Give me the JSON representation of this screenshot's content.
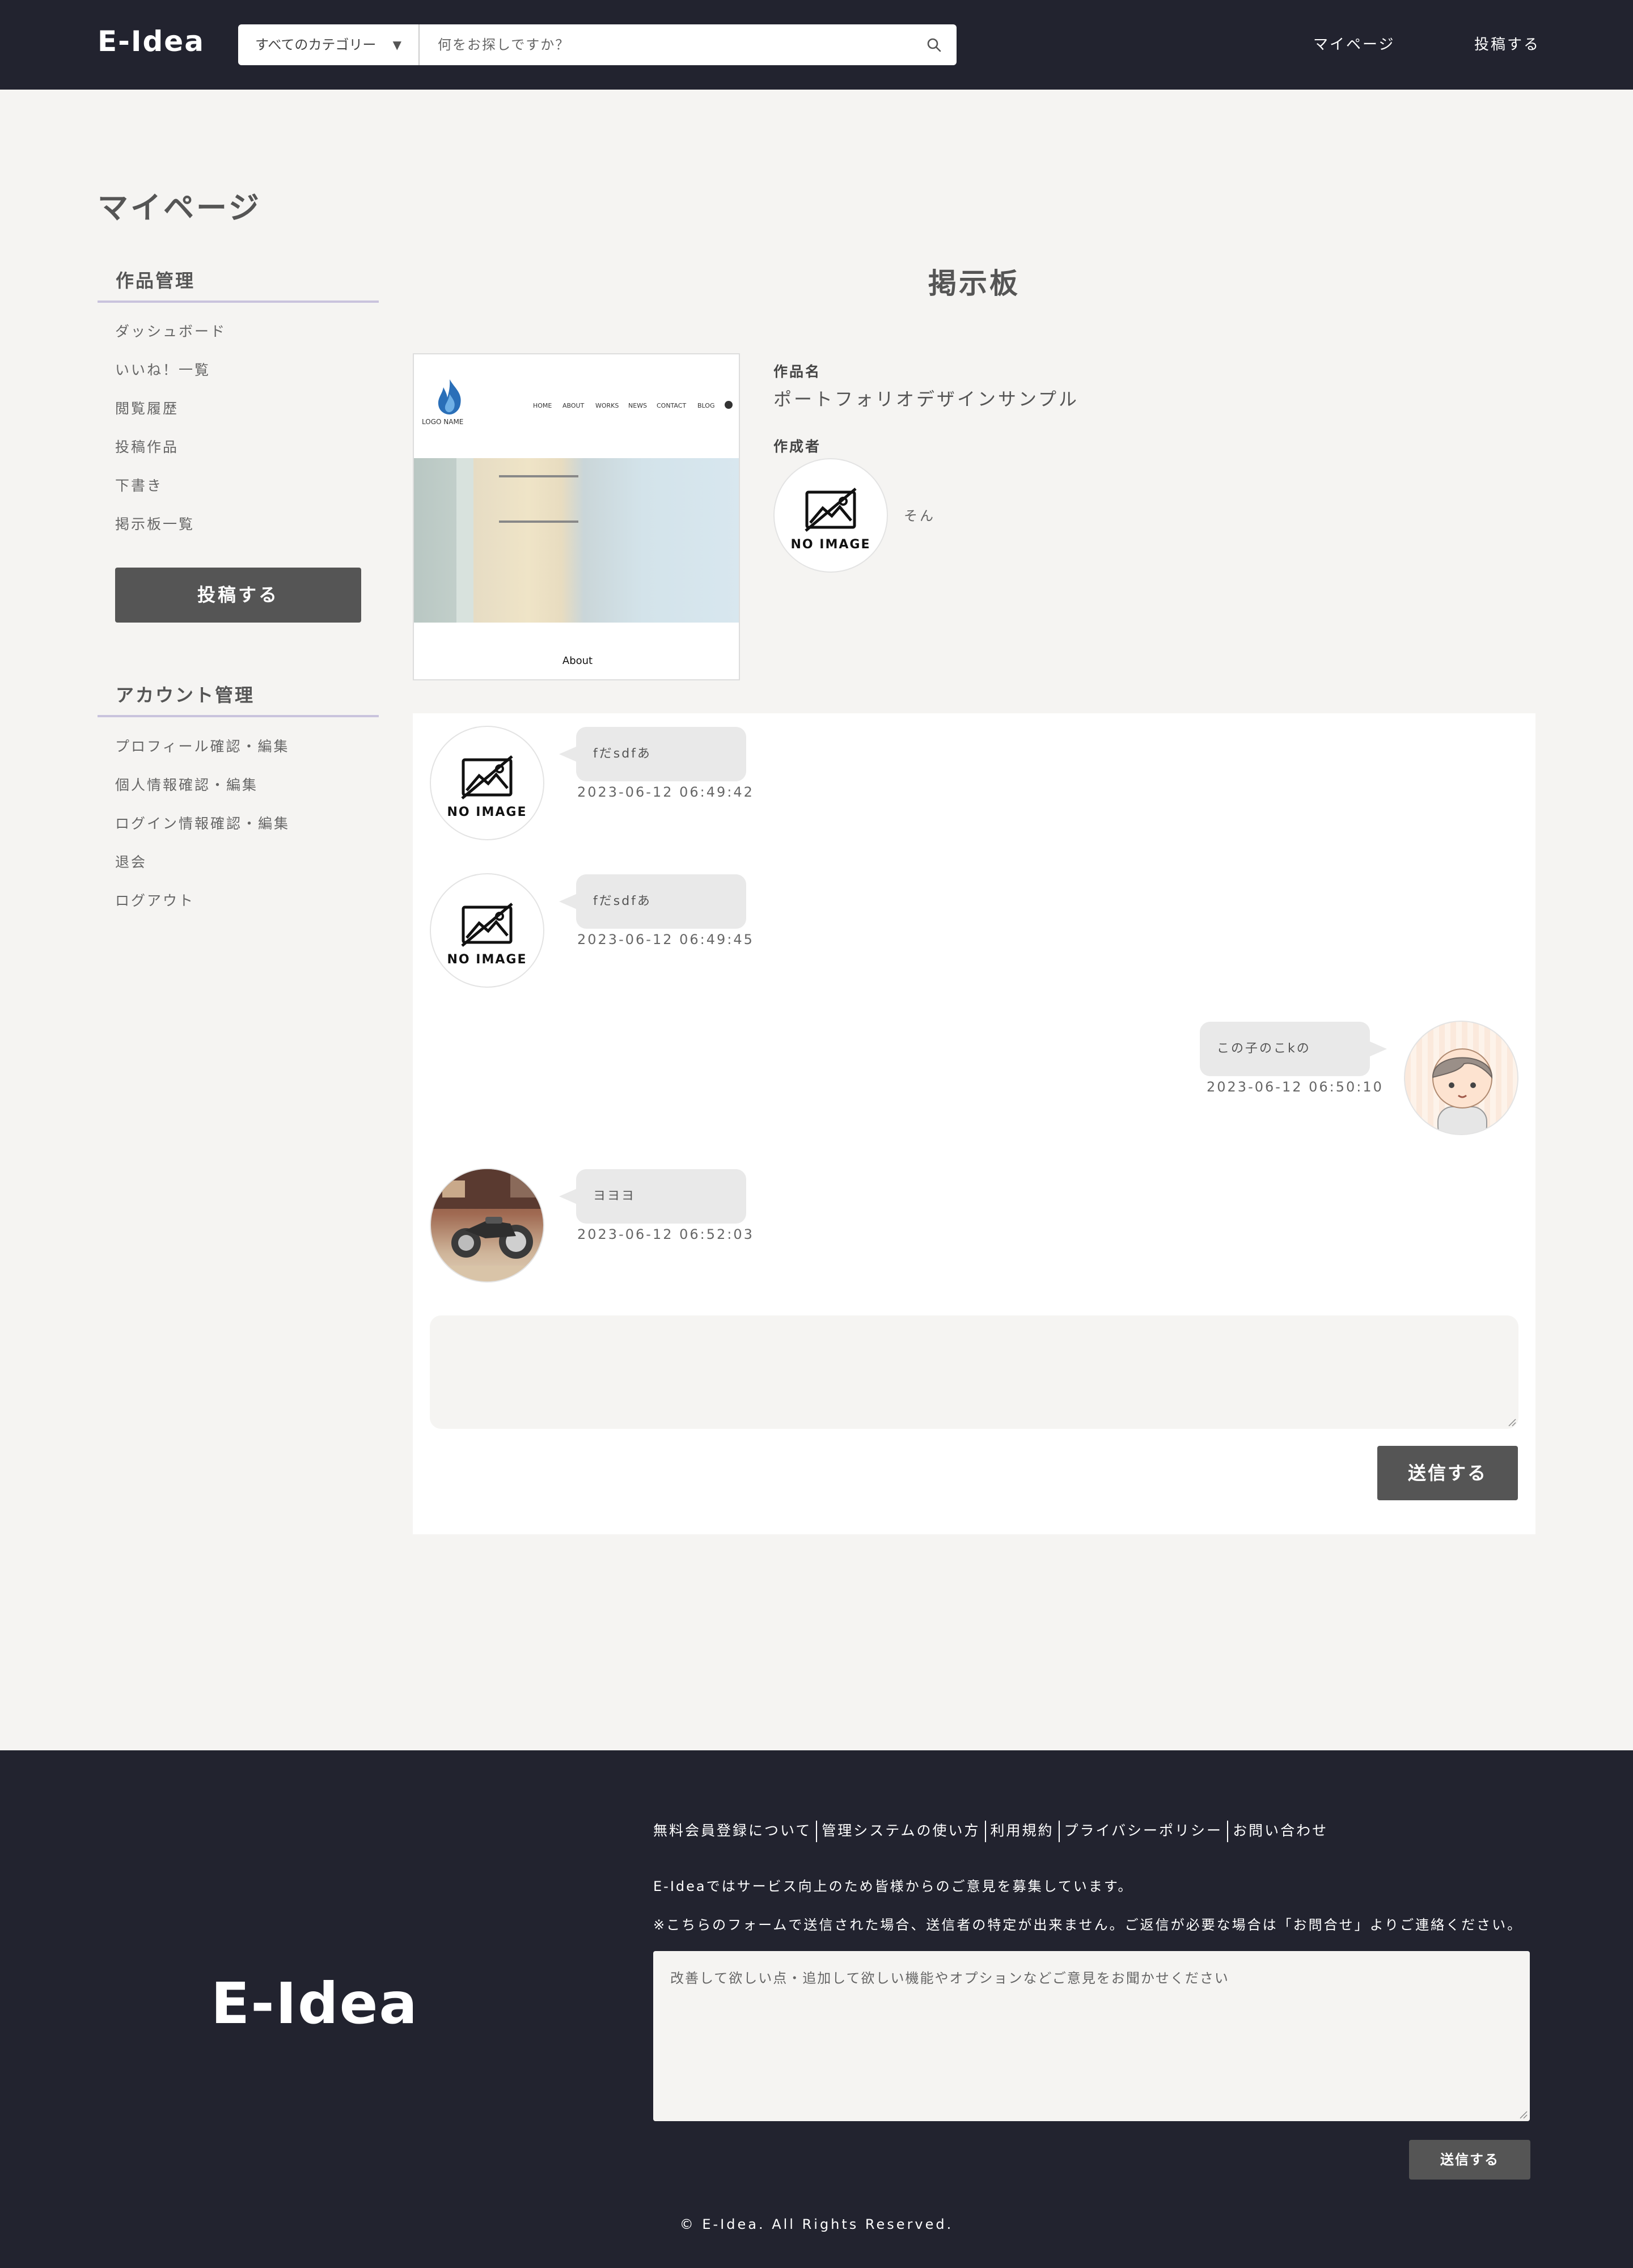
{
  "header": {
    "logo": "E-Idea",
    "category_select": "すべてのカテゴリー",
    "search_placeholder": "何をお探しですか？",
    "nav": [
      "マイページ",
      "投稿する"
    ]
  },
  "page_title": "マイページ",
  "sidebar": {
    "work_heading": "作品管理",
    "work_items": [
      "ダッシュボード",
      "いいね！一覧",
      "閲覧履歴",
      "投稿作品",
      "下書き",
      "掲示板一覧"
    ],
    "post_button": "投稿する",
    "account_heading": "アカウント管理",
    "account_items": [
      "プロフィール確認・編集",
      "個人情報確認・編集",
      "ログイン情報確認・編集",
      "退会",
      "ログアウト"
    ]
  },
  "board": {
    "title": "掲示板",
    "work_name_label": "作品名",
    "work_name": "ポートフォリオデザインサンプル",
    "creator_label": "作成者",
    "creator_name": "そん",
    "no_image": "NO IMAGE",
    "thumbnail": {
      "logo_text": "LOGO NAME",
      "nav": [
        "HOME",
        "ABOUT",
        "WORKS",
        "NEWS",
        "CONTACT",
        "BLOG"
      ],
      "section": "About"
    }
  },
  "messages": [
    {
      "text": "fだsdfあ",
      "time": "2023-06-12 06:49:42",
      "side": "left",
      "avatar": "no-image"
    },
    {
      "text": "fだsdfあ",
      "time": "2023-06-12 06:49:45",
      "side": "left",
      "avatar": "no-image"
    },
    {
      "text": "この子のこkの",
      "time": "2023-06-12 06:50:10",
      "side": "right",
      "avatar": "cartoon-boy"
    },
    {
      "text": "ヨヨヨ",
      "time": "2023-06-12 06:52:03",
      "side": "left",
      "avatar": "motorcycle-photo"
    }
  ],
  "chat_form": {
    "send_button": "送信する"
  },
  "footer": {
    "logo": "E-Idea",
    "links": [
      "無料会員登録について",
      "管理システムの使い方",
      "利用規約",
      "プライバシーポリシー",
      "お問い合わせ"
    ],
    "note1": "E-Ideaではサービス向上のため皆様からのご意見を募集しています。",
    "note2": "※こちらのフォームで送信された場合、送信者の特定が出来ません。ご返信が必要な場合は「お問合せ」よりご連絡ください。",
    "feedback_placeholder": "改善して欲しい点・追加して欲しい機能やオプションなどご意見をお聞かせください",
    "send_button": "送信する",
    "copyright": "© E-Idea. All Rights Reserved."
  },
  "colors": {
    "header_bg": "#22232f",
    "page_bg": "#f5f4f2",
    "button_bg": "#555555",
    "sidebar_underline": "#c9c3dd"
  }
}
